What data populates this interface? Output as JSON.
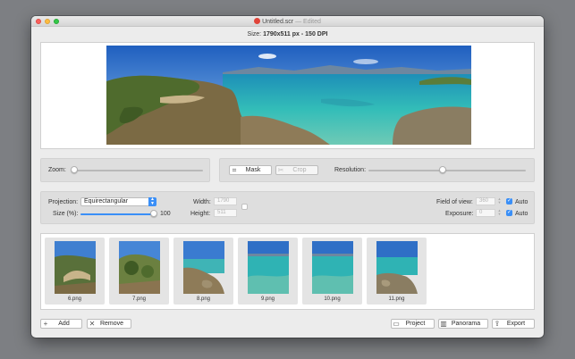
{
  "window": {
    "title": "Untitled.scr",
    "title_suffix": "— Edited"
  },
  "size_line": {
    "label": "Size:",
    "value": "1790x511 px - 150 DPI"
  },
  "zoom": {
    "label": "Zoom:",
    "level": 0.0
  },
  "mask_button": {
    "label": "Mask",
    "icon": "crop-mask-icon"
  },
  "crop_button": {
    "label": "Crop",
    "icon": "crop-icon",
    "enabled": false
  },
  "resolution": {
    "label": "Resolution:",
    "level": 0.47
  },
  "projection": {
    "label": "Projection:",
    "value": "Equirectangular"
  },
  "size_percent": {
    "label": "Size (%):",
    "value": "100",
    "level": 1.0
  },
  "width": {
    "label": "Width:",
    "value": "1790"
  },
  "height": {
    "label": "Height:",
    "value": "511"
  },
  "field_of_view": {
    "label": "Field of view:",
    "value": "360",
    "auto_label": "Auto",
    "auto": true
  },
  "exposure": {
    "label": "Exposure:",
    "value": "0",
    "auto_label": "Auto",
    "auto": true
  },
  "images": [
    {
      "name": "6.png",
      "theme": "hill"
    },
    {
      "name": "7.png",
      "theme": "shrub"
    },
    {
      "name": "8.png",
      "theme": "rocks"
    },
    {
      "name": "9.png",
      "theme": "sea"
    },
    {
      "name": "10.png",
      "theme": "sea"
    },
    {
      "name": "11.png",
      "theme": "shore"
    }
  ],
  "bottom_bar": {
    "add": "Add",
    "remove": "Remove",
    "project": "Project",
    "panorama": "Panorama",
    "export": "Export"
  },
  "colors": {
    "accent": "#3a8ff7",
    "sky": "#2f6fc6",
    "sea": "#2fb3b4",
    "land": "#7b6a44",
    "vegetation": "#4f6b2d"
  }
}
